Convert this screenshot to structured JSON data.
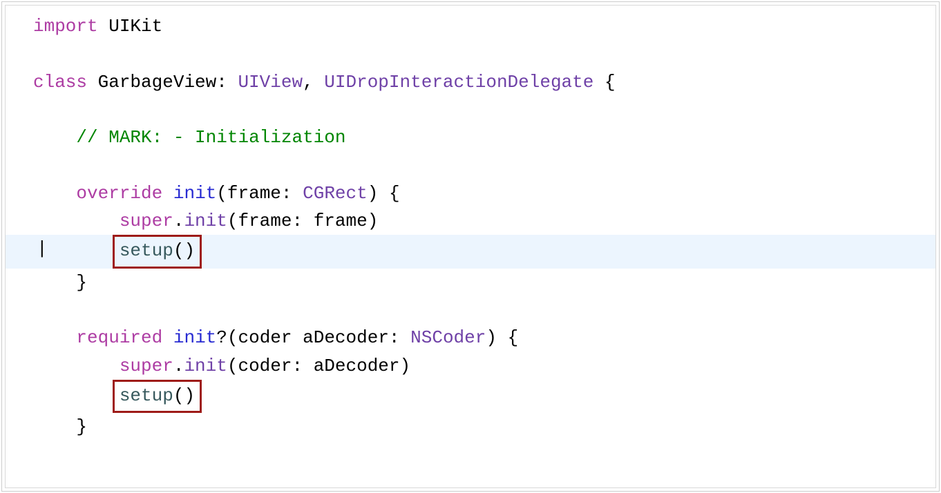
{
  "code": {
    "line1": {
      "import_kw": "import",
      "module": " UIKit"
    },
    "line3": {
      "class_kw": "class",
      "classname": " GarbageView: ",
      "type1": "UIView",
      "comma": ", ",
      "type2": "UIDropInteractionDelegate",
      "brace": " {"
    },
    "line5": {
      "comment": "// MARK: - Initialization"
    },
    "line7": {
      "override_kw": "override",
      "space1": " ",
      "init_kw": "init",
      "params1": "(frame: ",
      "cgrect": "CGRect",
      "params2": ") {"
    },
    "line8": {
      "super_kw": "super",
      "dot": ".",
      "init_call": "init",
      "params": "(frame: frame)"
    },
    "line9": {
      "setup": "setup",
      "parens": "()"
    },
    "line10": {
      "brace": "}"
    },
    "line12": {
      "required_kw": "required",
      "space1": " ",
      "init_kw": "init",
      "q": "?",
      "params1": "(coder aDecoder: ",
      "nscoder": "NSCoder",
      "params2": ") {"
    },
    "line13": {
      "super_kw": "super",
      "dot": ".",
      "init_call": "init",
      "params": "(coder: aDecoder)"
    },
    "line14": {
      "setup": "setup",
      "parens": "()"
    },
    "line15": {
      "brace": "}"
    }
  }
}
